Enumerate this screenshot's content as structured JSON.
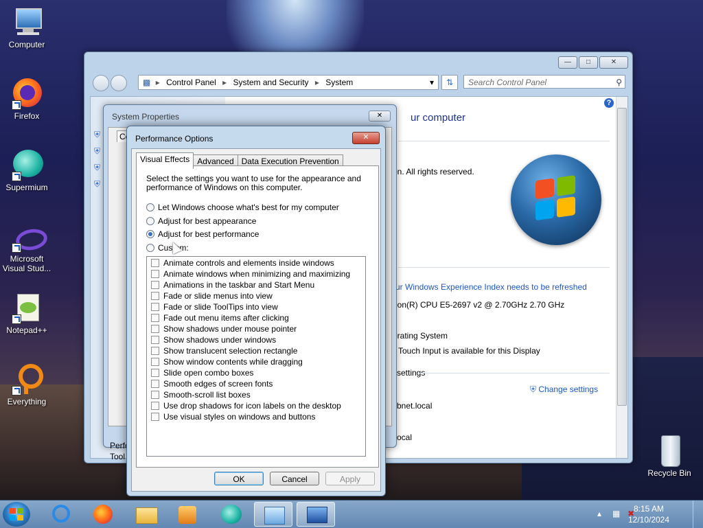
{
  "desktop": {
    "icons": [
      {
        "label": "Computer"
      },
      {
        "label": "Firefox"
      },
      {
        "label": "Supermium"
      },
      {
        "label": "Microsoft Visual Stud..."
      },
      {
        "label": "Notepad++"
      },
      {
        "label": "Everything"
      },
      {
        "label": "Recycle Bin"
      }
    ]
  },
  "control_panel": {
    "breadcrumb": [
      "Control Panel",
      "System and Security",
      "System"
    ],
    "search_placeholder": "Search Control Panel",
    "help": "?",
    "fragments": {
      "heading": "ur computer",
      "copyright": "on.  All rights reserved.",
      "wei": "ur Windows Experience Index needs to be refreshed",
      "cpu": "eon(R) CPU E5-2697 v2 @ 2.70GHz   2.70 GHz",
      "os": "erating System",
      "touch": "Touch Input is available for this Display",
      "settings": "settings",
      "change_settings": "Change settings",
      "domain1": "bnet.local",
      "domain2": "et.local"
    }
  },
  "system_properties": {
    "title": "System Properties",
    "partial_labels": [
      "Co",
      "Perfo",
      "Tool"
    ]
  },
  "perf_options": {
    "title": "Performance Options",
    "tabs": [
      "Visual Effects",
      "Advanced",
      "Data Execution Prevention"
    ],
    "description": "Select the settings you want to use for the appearance and performance of Windows on this computer.",
    "radios": [
      {
        "label": "Let Windows choose what's best for my computer",
        "selected": false
      },
      {
        "label": "Adjust for best appearance",
        "selected": false
      },
      {
        "label": "Adjust for best performance",
        "selected": true
      },
      {
        "label": "Custom:",
        "selected": false
      }
    ],
    "effects": [
      "Animate controls and elements inside windows",
      "Animate windows when minimizing and maximizing",
      "Animations in the taskbar and Start Menu",
      "Fade or slide menus into view",
      "Fade or slide ToolTips into view",
      "Fade out menu items after clicking",
      "Show shadows under mouse pointer",
      "Show shadows under windows",
      "Show translucent selection rectangle",
      "Show window contents while dragging",
      "Slide open combo boxes",
      "Smooth edges of screen fonts",
      "Smooth-scroll list boxes",
      "Use drop shadows for icon labels on the desktop",
      "Use visual styles on windows and buttons"
    ],
    "buttons": {
      "ok": "OK",
      "cancel": "Cancel",
      "apply": "Apply"
    }
  },
  "taskbar": {
    "time": "8:15 AM",
    "date": "12/10/2024"
  }
}
